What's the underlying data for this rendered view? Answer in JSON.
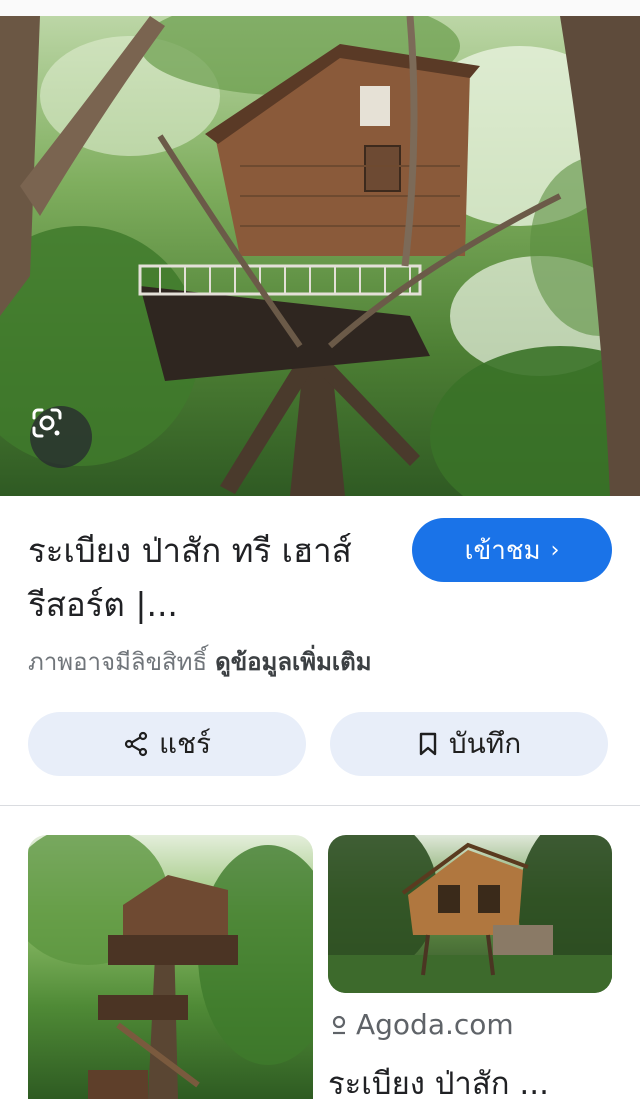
{
  "image_result": {
    "title": "ระเบียง ป่าสัก ทรี เฮาส์ รีสอร์ต |...",
    "visit_label": "เข้าชม",
    "visit_chevron": "›",
    "copyright_text": "ภาพอาจมีลิขสิทธิ์",
    "more_info_label": "ดูข้อมูลเพิ่มเติม"
  },
  "actions": {
    "share_label": "แชร์",
    "save_label": "บันทึก"
  },
  "related": [
    {
      "source": "",
      "title": ""
    },
    {
      "source": "Agoda.com",
      "title": "ระเบียง ป่าสัก ..."
    }
  ],
  "colors": {
    "accent": "#1a73e8",
    "pill_bg": "#e8eef9",
    "muted_text": "#70757a"
  },
  "icons": {
    "lens": "google-lens-icon",
    "share": "share-icon",
    "save": "bookmark-icon",
    "source": "search-icon"
  }
}
